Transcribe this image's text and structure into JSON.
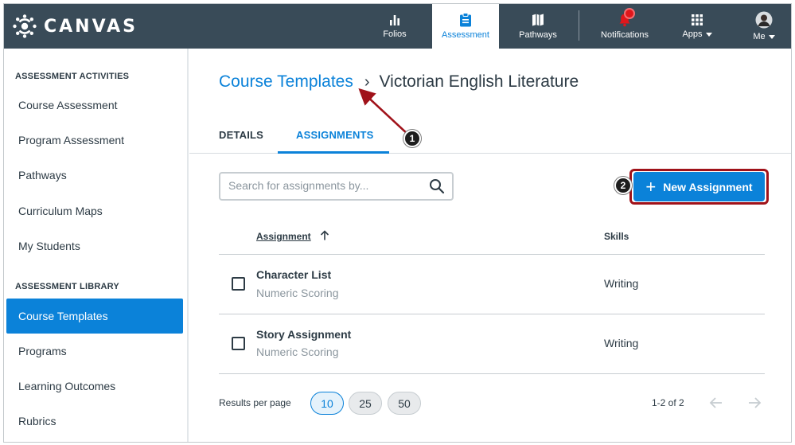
{
  "app": {
    "name": "CANVAS"
  },
  "topnav": {
    "items": [
      {
        "label": "Folios",
        "icon": "bar-chart-icon"
      },
      {
        "label": "Assessment",
        "icon": "clipboard-icon",
        "active": true
      },
      {
        "label": "Pathways",
        "icon": "map-icon"
      },
      {
        "label": "Notifications",
        "icon": "bell-icon",
        "has_alert": true
      },
      {
        "label": "Apps",
        "icon": "grid-icon"
      },
      {
        "label": "Me",
        "icon": "avatar"
      }
    ]
  },
  "sidebar": {
    "section1_heading": "ASSESSMENT ACTIVITIES",
    "section1_items": [
      {
        "label": "Course Assessment"
      },
      {
        "label": "Program Assessment"
      },
      {
        "label": "Pathways"
      },
      {
        "label": "Curriculum Maps"
      },
      {
        "label": "My Students"
      }
    ],
    "section2_heading": "ASSESSMENT LIBRARY",
    "section2_items": [
      {
        "label": "Course Templates",
        "active": true
      },
      {
        "label": "Programs"
      },
      {
        "label": "Learning Outcomes"
      },
      {
        "label": "Rubrics"
      }
    ]
  },
  "breadcrumb": {
    "parent": "Course Templates",
    "separator": "›",
    "current": "Victorian English Literature"
  },
  "tabs": [
    {
      "label": "DETAILS"
    },
    {
      "label": "ASSIGNMENTS",
      "active": true
    }
  ],
  "search": {
    "placeholder": "Search for assignments by...",
    "value": ""
  },
  "new_assignment": {
    "label": "New Assignment"
  },
  "callouts": [
    "1",
    "2"
  ],
  "table": {
    "headers": {
      "assignment": "Assignment",
      "skills": "Skills"
    },
    "sort": "ascending",
    "rows": [
      {
        "title": "Character List",
        "subtitle": "Numeric Scoring",
        "skill": "Writing"
      },
      {
        "title": "Story Assignment",
        "subtitle": "Numeric Scoring",
        "skill": "Writing"
      }
    ]
  },
  "pagination": {
    "results_label": "Results per page",
    "options": [
      "10",
      "25",
      "50"
    ],
    "selected": "10",
    "range": "1-2 of 2"
  },
  "colors": {
    "nav_bg": "#394b58",
    "accent": "#0b82d9",
    "annotation": "#a0121a",
    "alert": "#e0161b"
  }
}
